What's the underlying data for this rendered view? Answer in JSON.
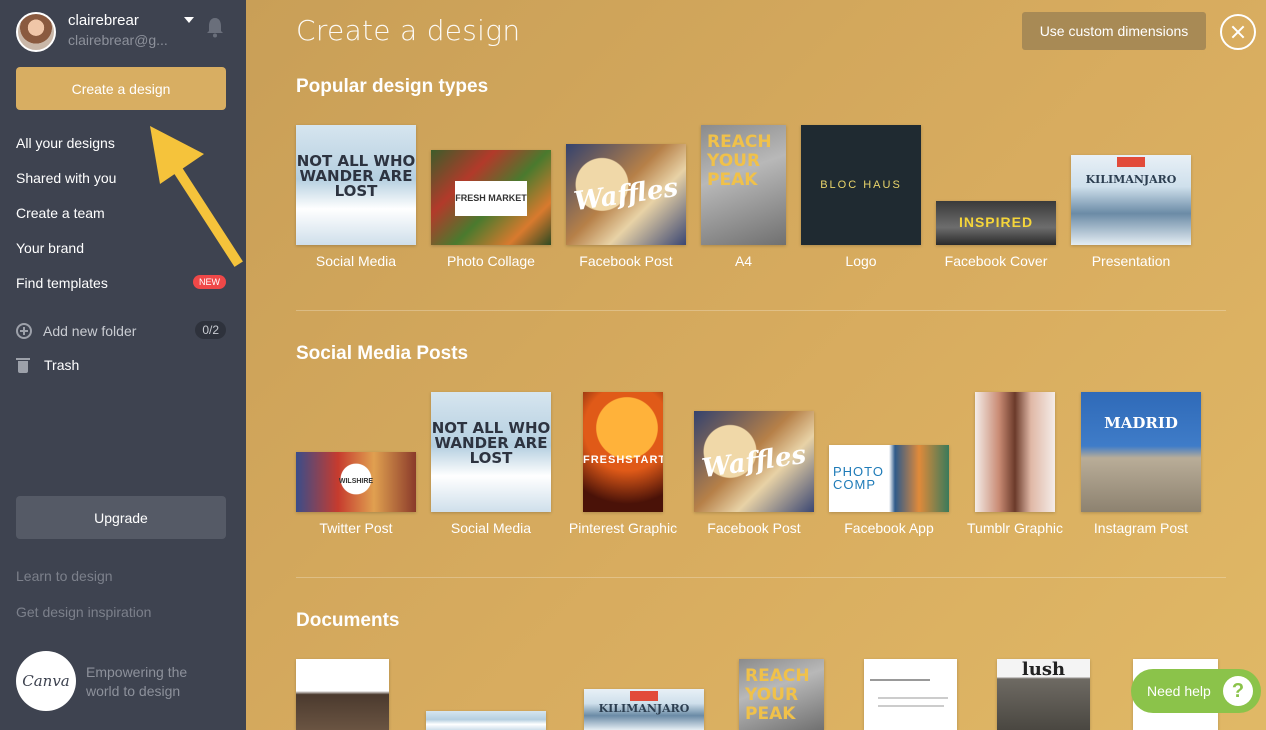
{
  "user": {
    "name": "clairebrear",
    "email": "clairebrear@g..."
  },
  "sidebar": {
    "create_label": "Create a design",
    "nav": [
      {
        "label": "All your designs"
      },
      {
        "label": "Shared with you"
      },
      {
        "label": "Create a team"
      },
      {
        "label": "Your brand"
      },
      {
        "label": "Find templates",
        "badge": "NEW"
      }
    ],
    "add_folder": {
      "label": "Add new folder",
      "count": "0/2"
    },
    "trash_label": "Trash",
    "upgrade_label": "Upgrade",
    "links": [
      "Learn to design",
      "Get design inspiration"
    ],
    "brand": {
      "logo": "Canva",
      "tagline": "Empowering the world to design"
    }
  },
  "main": {
    "title": "Create a design",
    "custom_dimensions_label": "Use custom dimensions",
    "sections": [
      {
        "title": "Popular design types",
        "items": [
          {
            "label": "Social Media",
            "thumb_text": "NOT ALL WHO WANDER ARE LOST"
          },
          {
            "label": "Photo Collage",
            "thumb_text": "FRESH MARKET"
          },
          {
            "label": "Facebook Post",
            "thumb_text": "Waffles"
          },
          {
            "label": "A4",
            "thumb_text": "REACH YOUR PEAK"
          },
          {
            "label": "Logo",
            "thumb_text": "BLOC HAUS"
          },
          {
            "label": "Facebook Cover",
            "thumb_text": "INSPIRED"
          },
          {
            "label": "Presentation",
            "thumb_text": "KILIMANJARO"
          }
        ]
      },
      {
        "title": "Social Media Posts",
        "items": [
          {
            "label": "Twitter Post",
            "thumb_text": "WILSHIRE"
          },
          {
            "label": "Social Media",
            "thumb_text": "NOT ALL WHO WANDER ARE LOST"
          },
          {
            "label": "Pinterest Graphic",
            "thumb_text": "FRESHSTART"
          },
          {
            "label": "Facebook Post",
            "thumb_text": "Waffles"
          },
          {
            "label": "Facebook App",
            "thumb_text": "PHOTO COMP"
          },
          {
            "label": "Tumblr Graphic",
            "thumb_text": ""
          },
          {
            "label": "Instagram Post",
            "thumb_text": "MADRID"
          }
        ]
      },
      {
        "title": "Documents",
        "items": [
          {
            "thumb_text": ""
          },
          {
            "thumb_text": ""
          },
          {
            "thumb_text": "KILIMANJARO"
          },
          {
            "thumb_text": "REACH YOUR PEAK"
          },
          {
            "thumb_text": ""
          },
          {
            "thumb_text": "lush"
          },
          {
            "thumb_text": ""
          }
        ]
      }
    ]
  },
  "help": {
    "label": "Need help",
    "icon": "?"
  }
}
